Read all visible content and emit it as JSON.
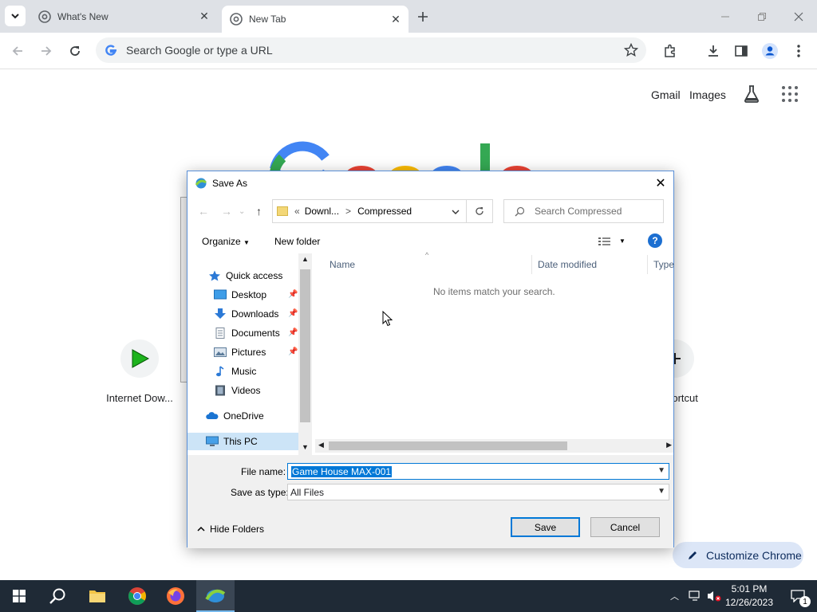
{
  "browser": {
    "tabs": [
      {
        "title": "What's New",
        "active": false
      },
      {
        "title": "New Tab",
        "active": true
      }
    ],
    "omnibox_placeholder": "Search Google or type a URL"
  },
  "ntp": {
    "links": {
      "gmail": "Gmail",
      "images": "Images"
    },
    "shortcuts": [
      {
        "label": "Internet Dow..."
      },
      {
        "label": "hortcut"
      }
    ],
    "customize_label": "Customize Chrome"
  },
  "dialog": {
    "title": "Save As",
    "address": {
      "prefix": "«",
      "crumb1": "Downl...",
      "sep": ">",
      "crumb2": "Compressed"
    },
    "search_placeholder": "Search Compressed",
    "organize_label": "Organize",
    "new_folder_label": "New folder",
    "nav": {
      "quick_access": "Quick access",
      "items": [
        "Desktop",
        "Downloads",
        "Documents",
        "Pictures",
        "Music",
        "Videos"
      ],
      "onedrive": "OneDrive",
      "thispc": "This PC"
    },
    "columns": {
      "name": "Name",
      "date": "Date modified",
      "type": "Type"
    },
    "empty_message": "No items match your search.",
    "file_name_label": "File name:",
    "file_name_value": "Game House MAX-001",
    "save_type_label": "Save as type:",
    "save_type_value": "All Files",
    "hide_folders": "Hide Folders",
    "save_button": "Save",
    "cancel_button": "Cancel"
  },
  "taskbar": {
    "time": "5:01 PM",
    "date": "12/26/2023",
    "notification_count": "1"
  }
}
